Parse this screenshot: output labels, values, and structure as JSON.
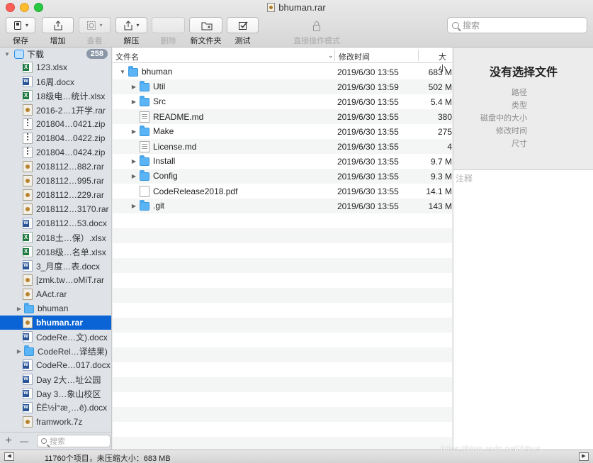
{
  "window": {
    "title": "bhuman.rar"
  },
  "toolbar": {
    "save": "保存",
    "add": "增加",
    "view": "查看",
    "extract": "解压",
    "delete": "删除",
    "new_folder": "新文件夹",
    "test": "测试",
    "direct_mode": "直接操作模式",
    "search_placeholder": "搜索"
  },
  "sidebar": {
    "root_label": "下载",
    "root_count": "258",
    "items": [
      {
        "name": "123.xlsx",
        "type": "xlsx"
      },
      {
        "name": "16周.docx",
        "type": "docx"
      },
      {
        "name": "18级电…统计.xlsx",
        "type": "xlsx"
      },
      {
        "name": "2016-2…1开学.rar",
        "type": "rar"
      },
      {
        "name": "201804…0421.zip",
        "type": "zip"
      },
      {
        "name": "201804…0422.zip",
        "type": "zip"
      },
      {
        "name": "201804…0424.zip",
        "type": "zip"
      },
      {
        "name": "2018112…882.rar",
        "type": "rar"
      },
      {
        "name": "2018112…995.rar",
        "type": "rar"
      },
      {
        "name": "2018112…229.rar",
        "type": "rar"
      },
      {
        "name": "2018112…3170.rar",
        "type": "rar"
      },
      {
        "name": "2018112…53.docx",
        "type": "docx"
      },
      {
        "name": "2018土…保）.xlsx",
        "type": "xlsx"
      },
      {
        "name": "2018级…名单.xlsx",
        "type": "xlsx"
      },
      {
        "name": "3_月度…表.docx",
        "type": "docx"
      },
      {
        "name": "[zmk.tw…oMiT.rar",
        "type": "rar"
      },
      {
        "name": "AAct.rar",
        "type": "rar"
      },
      {
        "name": "bhuman",
        "type": "folder"
      },
      {
        "name": "bhuman.rar",
        "type": "rar"
      },
      {
        "name": "CodeRe…文).docx",
        "type": "docx"
      },
      {
        "name": "CodeRel…译结果)",
        "type": "folder"
      },
      {
        "name": "CodeRe…017.docx",
        "type": "docx"
      },
      {
        "name": "Day 2大…址公园",
        "type": "docx"
      },
      {
        "name": "Day 3…象山校区",
        "type": "docx"
      },
      {
        "name": "ÈË½Ì°æ¸…ê).docx",
        "type": "docx"
      },
      {
        "name": "framwork.7z",
        "type": "rar"
      }
    ],
    "search_placeholder": "搜索",
    "add_symbol": "+",
    "remove_symbol": "—"
  },
  "list": {
    "columns": {
      "name": "文件名",
      "modified": "修改时间",
      "size": "大小"
    },
    "rows": [
      {
        "name": "bhuman",
        "date": "2019/6/30 13:55",
        "size": "683 M",
        "type": "folder",
        "level": 0,
        "expanded": true
      },
      {
        "name": "Util",
        "date": "2019/6/30 13:59",
        "size": "502 M",
        "type": "folder",
        "level": 1
      },
      {
        "name": "Src",
        "date": "2019/6/30 13:55",
        "size": "5.4 M",
        "type": "folder",
        "level": 1
      },
      {
        "name": "README.md",
        "date": "2019/6/30 13:55",
        "size": "380",
        "type": "doc",
        "level": 1
      },
      {
        "name": "Make",
        "date": "2019/6/30 13:55",
        "size": "275",
        "type": "folder",
        "level": 1
      },
      {
        "name": "License.md",
        "date": "2019/6/30 13:55",
        "size": "4",
        "type": "doc",
        "level": 1
      },
      {
        "name": "Install",
        "date": "2019/6/30 13:55",
        "size": "9.7 M",
        "type": "folder",
        "level": 1
      },
      {
        "name": "Config",
        "date": "2019/6/30 13:55",
        "size": "9.3 M",
        "type": "folder",
        "level": 1
      },
      {
        "name": "CodeRelease2018.pdf",
        "date": "2019/6/30 13:55",
        "size": "14.1 M",
        "type": "blank",
        "level": 1
      },
      {
        "name": ".git",
        "date": "2019/6/30 13:55",
        "size": "143 M",
        "type": "folder",
        "level": 1
      }
    ]
  },
  "info": {
    "title": "没有选择文件",
    "path": "路径",
    "kind": "类型",
    "disk_size": "磁盘中的大小",
    "modified": "修改时间",
    "dimensions": "尺寸",
    "note_placeholder": "注释"
  },
  "status": {
    "text": "11760个项目，未压缩大小：683 MB"
  },
  "watermark": "https://blog.csdn.net/Athus"
}
